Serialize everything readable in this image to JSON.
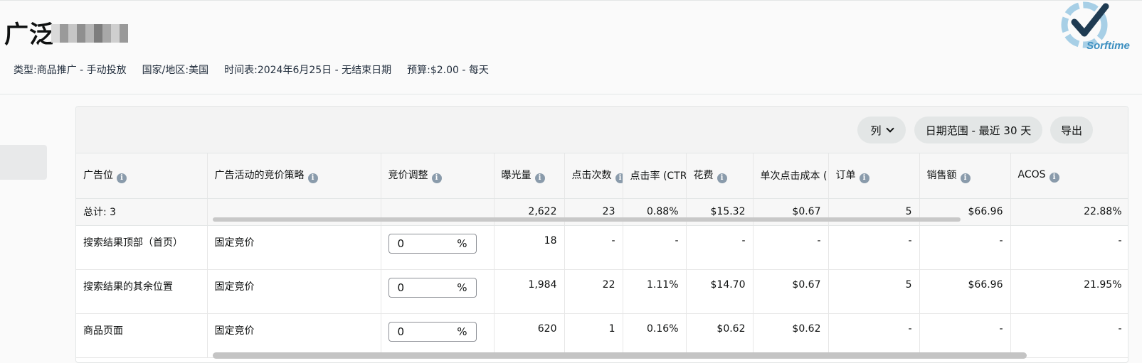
{
  "campaign": {
    "title": "广泛",
    "type": "类型:商品推广 - 手动投放",
    "country": "国家/地区:美国",
    "schedule": "时间表:2024年6月25日 - 无结束日期",
    "budget": "预算:$2.00 - 每天"
  },
  "logo": {
    "text": "Sorftime"
  },
  "toolbar": {
    "columns_label": "列",
    "date_range_label": "日期范围 - 最近 30 天",
    "export_label": "导出"
  },
  "table": {
    "headers": [
      "广告位",
      "广告活动的竞价策略",
      "竞价调整",
      "曝光量",
      "点击次数",
      "点击率 (CTR",
      "花费",
      "单次点击成本 (",
      "订单",
      "销售额",
      "ACOS"
    ],
    "total": {
      "label": "总计: 3",
      "impressions": "2,622",
      "clicks": "23",
      "ctr": "0.88%",
      "spend": "$15.32",
      "cpc": "$0.67",
      "orders": "5",
      "sales": "$66.96",
      "acos": "22.88%"
    },
    "rows": [
      {
        "placement": "搜索结果顶部（首页）",
        "strategy": "固定竞价",
        "bid": "0",
        "unit": "%",
        "impressions": "18",
        "clicks": "-",
        "ctr": "-",
        "spend": "-",
        "cpc": "-",
        "orders": "-",
        "sales": "-",
        "acos": "-"
      },
      {
        "placement": "搜索结果的其余位置",
        "strategy": "固定竞价",
        "bid": "0",
        "unit": "%",
        "impressions": "1,984",
        "clicks": "22",
        "ctr": "1.11%",
        "spend": "$14.70",
        "cpc": "$0.67",
        "orders": "5",
        "sales": "$66.96",
        "acos": "21.95%"
      },
      {
        "placement": "商品页面",
        "strategy": "固定竞价",
        "bid": "0",
        "unit": "%",
        "impressions": "620",
        "clicks": "1",
        "ctr": "0.16%",
        "spend": "$0.62",
        "cpc": "$0.62",
        "orders": "-",
        "sales": "-",
        "acos": "-"
      }
    ]
  },
  "colors": {
    "accent": "#3c8fc0",
    "logo_dark": "#1f3b52",
    "info_icon": "#8a9bab"
  }
}
